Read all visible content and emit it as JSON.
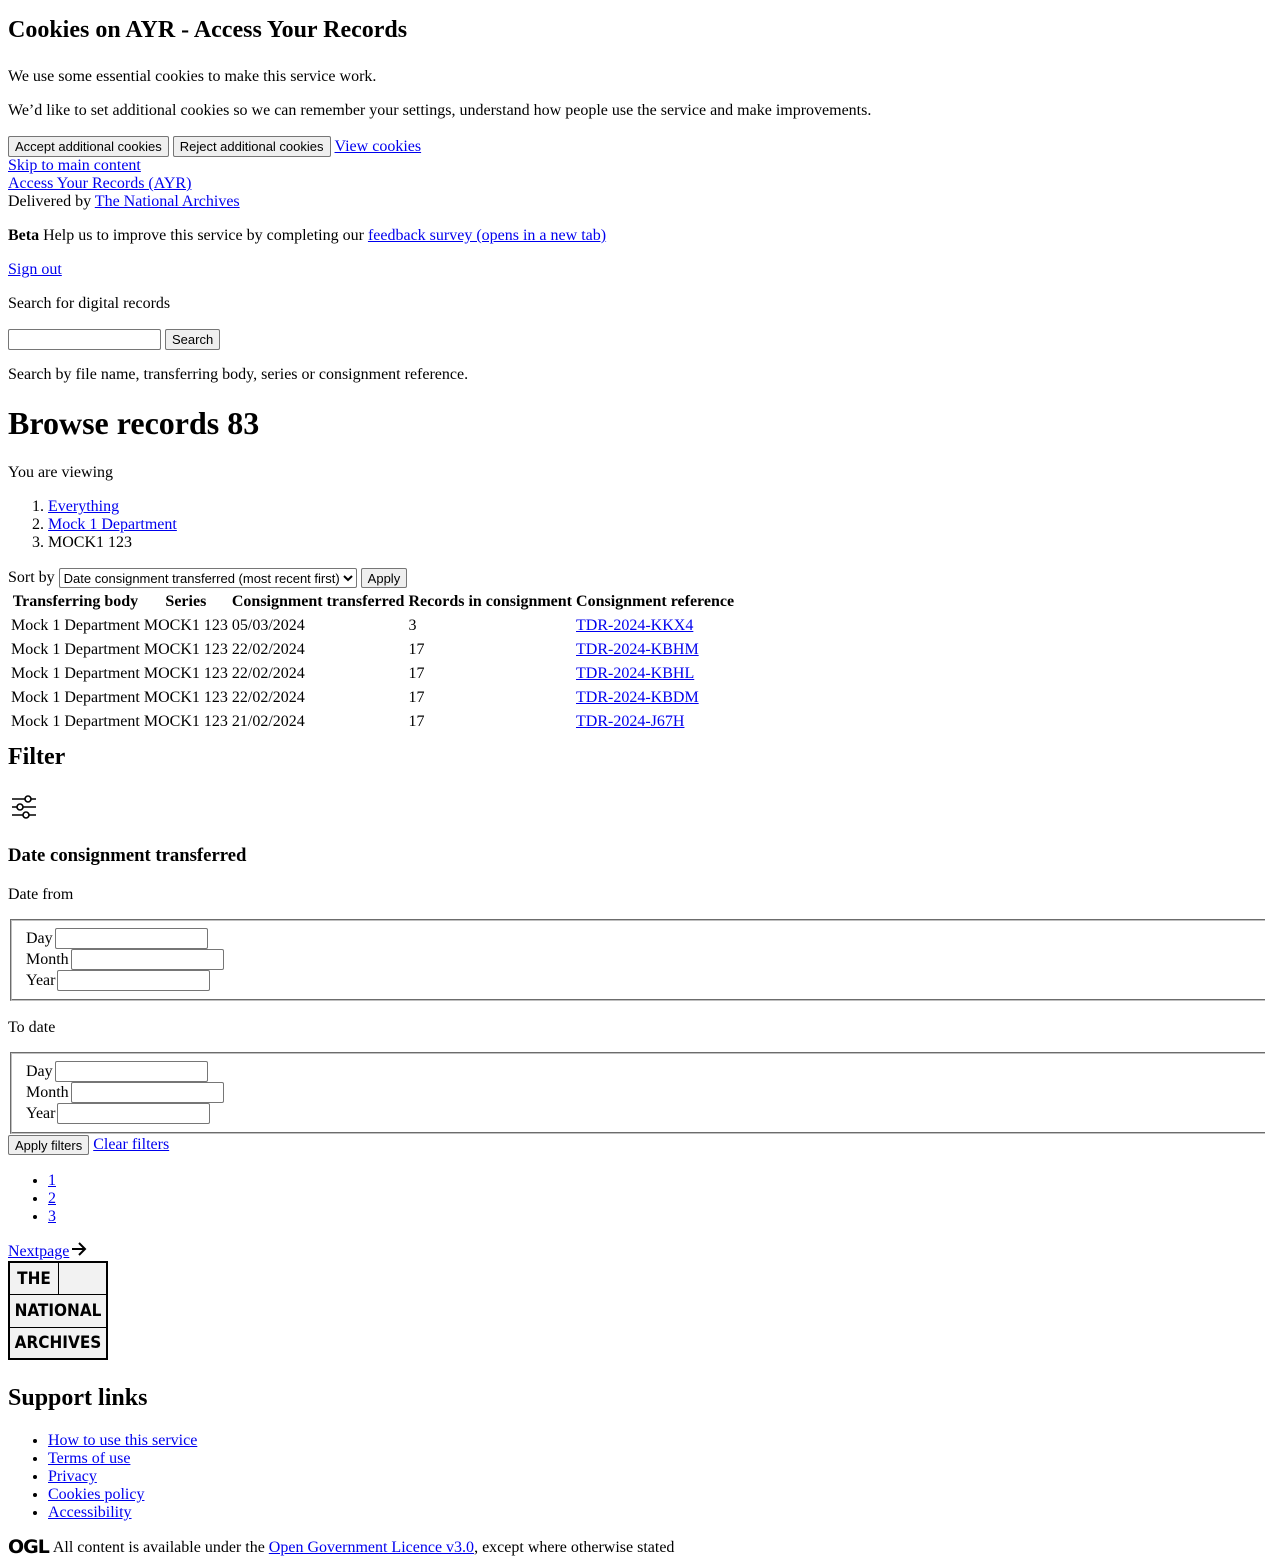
{
  "cookie_banner": {
    "heading": "Cookies on AYR - Access Your Records",
    "para1": "We use some essential cookies to make this service work.",
    "para2": "We’d like to set additional cookies so we can remember your settings, understand how people use the service and make improvements.",
    "accept_label": "Accept additional cookies",
    "reject_label": "Reject additional cookies",
    "view_label": "View cookies"
  },
  "header": {
    "skip_link": "Skip to main content",
    "service_name": "Access Your Records (AYR)",
    "delivered_by_text": "Delivered by",
    "delivered_by_link": "The National Archives"
  },
  "beta_banner": {
    "tag": "Beta",
    "text": "Help us to improve this service by completing our",
    "link": "feedback survey (opens in a new tab)"
  },
  "sign_out": "Sign out",
  "search": {
    "label": "Search for digital records",
    "value": "",
    "button": "Search",
    "hint": "Search by file name, transferring body, series or consignment reference."
  },
  "main": {
    "title": "Browse records 83",
    "viewing_label": "You are viewing",
    "breadcrumbs": [
      "Everything",
      "Mock 1 Department",
      "MOCK1 123"
    ],
    "sort_label": "Sort by",
    "sort_selected": "Date consignment transferred (most recent first)",
    "sort_apply": "Apply"
  },
  "table": {
    "headers": [
      "Transferring body",
      "Series",
      "Consignment transferred",
      "Records in consignment",
      "Consignment reference"
    ],
    "rows": [
      [
        "Mock 1 Department",
        "MOCK1 123",
        "05/03/2024",
        "3",
        "TDR-2024-KKX4"
      ],
      [
        "Mock 1 Department",
        "MOCK1 123",
        "22/02/2024",
        "17",
        "TDR-2024-KBHM"
      ],
      [
        "Mock 1 Department",
        "MOCK1 123",
        "22/02/2024",
        "17",
        "TDR-2024-KBHL"
      ],
      [
        "Mock 1 Department",
        "MOCK1 123",
        "22/02/2024",
        "17",
        "TDR-2024-KBDM"
      ],
      [
        "Mock 1 Department",
        "MOCK1 123",
        "21/02/2024",
        "17",
        "TDR-2024-J67H"
      ]
    ]
  },
  "filter": {
    "heading": "Filter",
    "icon": "filter-sliders-icon",
    "subheading": "Date consignment transferred",
    "date_from_label": "Date from",
    "to_date_label": "To date",
    "day_label": "Day",
    "month_label": "Month",
    "year_label": "Year",
    "apply_label": "Apply filters",
    "clear_label": "Clear filters"
  },
  "pagination": {
    "pages": [
      "1",
      "2",
      "3"
    ],
    "next_label": "Nextpage",
    "next_icon": "arrow-right-icon"
  },
  "logo": {
    "line1": "THE",
    "line2": "NATIONAL",
    "line3": "ARCHIVES"
  },
  "footer": {
    "support_heading": "Support links",
    "links": [
      "How to use this service",
      "Terms of use",
      "Privacy",
      "Cookies policy",
      "Accessibility"
    ],
    "ogl_logo": "OGL",
    "licence_text_before": "All content is available under the",
    "licence_link": "Open Government Licence v3.0",
    "licence_text_after": ", except where otherwise stated"
  }
}
